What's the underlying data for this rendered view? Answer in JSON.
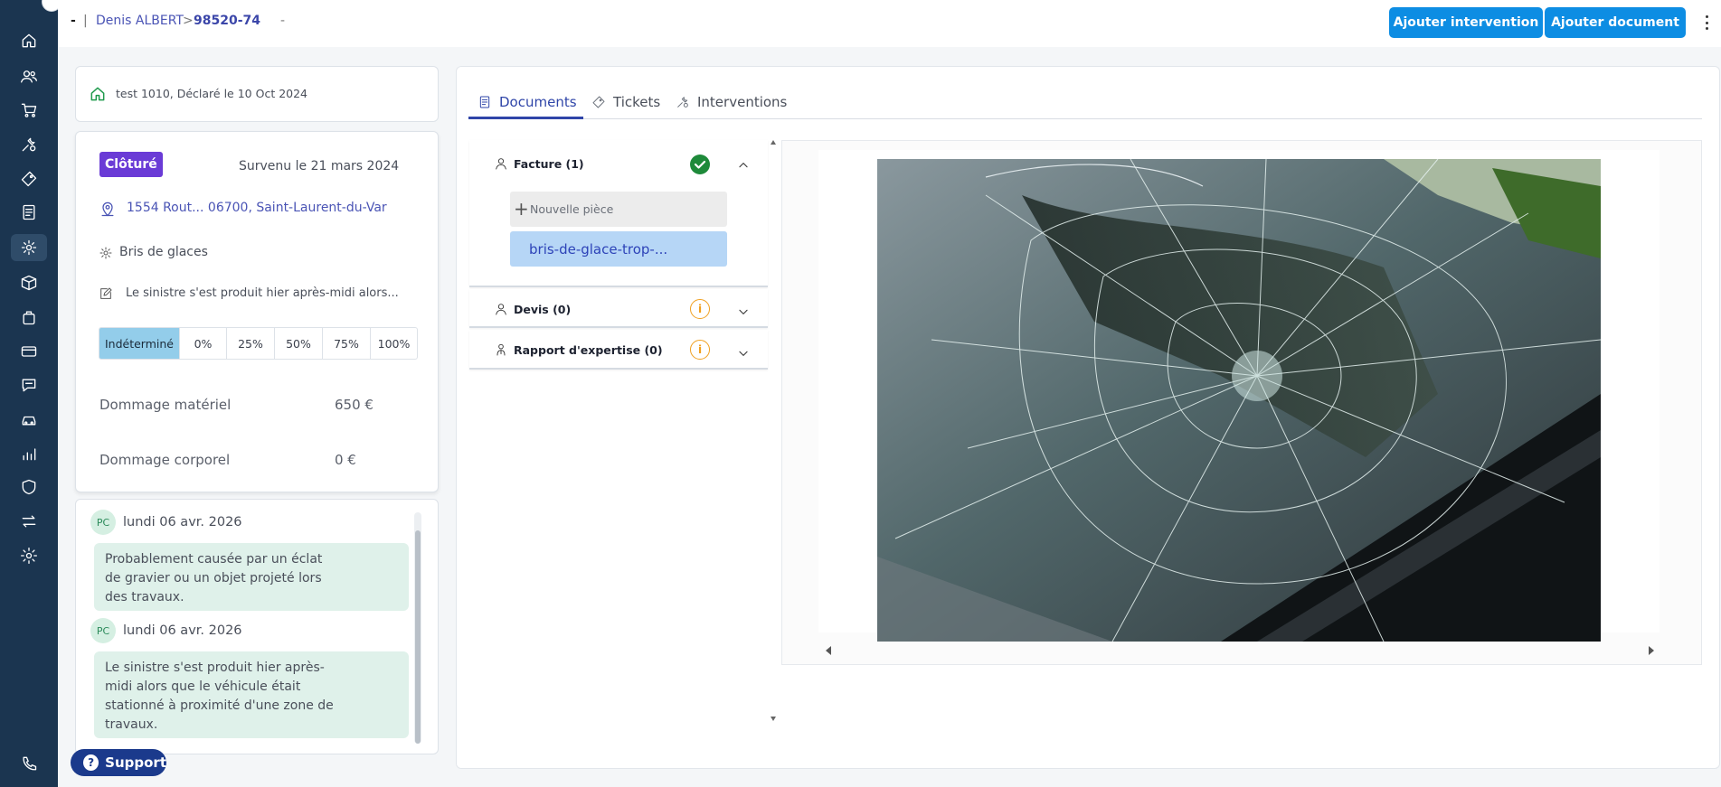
{
  "header": {
    "breadcrumb_dash": "-",
    "breadcrumb_sep": "|",
    "client_name": "Denis ALBERT",
    "chevron": ">",
    "case_id": "98520-74",
    "trailing_dash": "-",
    "add_intervention_label": "Ajouter intervention",
    "add_document_label": "Ajouter document"
  },
  "sidebar": {
    "items": [
      {
        "icon": "home-icon"
      },
      {
        "icon": "users-icon"
      },
      {
        "icon": "cart-icon"
      },
      {
        "icon": "tools-icon"
      },
      {
        "icon": "ticket-icon"
      },
      {
        "icon": "document-icon"
      },
      {
        "icon": "claims-icon"
      },
      {
        "icon": "box-icon"
      },
      {
        "icon": "bag-icon"
      },
      {
        "icon": "card-icon"
      },
      {
        "icon": "chat-icon"
      },
      {
        "icon": "car-icon"
      },
      {
        "icon": "stats-icon"
      },
      {
        "icon": "shield-icon"
      },
      {
        "icon": "transfer-icon"
      },
      {
        "icon": "settings-icon"
      }
    ],
    "bottom_icon": "phone-icon",
    "active_index": 6
  },
  "claim": {
    "summary": "test 1010, Déclaré le 10 Oct 2024",
    "status_badge": "Clôturé",
    "survenu": "Survenu le 21 mars 2024",
    "address": "1554 Rout...  06700, Saint-Laurent-du-Var",
    "type": "Bris de glaces",
    "description": "Le sinistre s'est produit hier après-midi alors...",
    "responsibility_options": [
      "Indéterminé",
      "0%",
      "25%",
      "50%",
      "75%",
      "100%"
    ],
    "responsibility_selected": "Indéterminé",
    "damage_material_label": "Dommage matériel",
    "damage_material_value": "650 €",
    "damage_bodily_label": "Dommage corporel",
    "damage_bodily_value": "0 €"
  },
  "notes": [
    {
      "initials": "PC",
      "date": "lundi 06 avr. 2026",
      "text": "Probablement causée par un éclat de gravier ou un objet projeté lors des travaux."
    },
    {
      "initials": "PC",
      "date": "lundi 06 avr. 2026",
      "text": "Le sinistre s'est produit hier après-midi alors que le véhicule était stationné à proximité d'une zone de travaux."
    }
  ],
  "support_label": "Support",
  "tabs": [
    {
      "label": "Documents",
      "icon": "document-icon",
      "active": true
    },
    {
      "label": "Tickets",
      "icon": "ticket-icon",
      "active": false
    },
    {
      "label": "Interventions",
      "icon": "tools-icon",
      "active": false
    }
  ],
  "documents": {
    "sections": [
      {
        "title": "Facture (1)",
        "status": "ok",
        "expanded": true
      },
      {
        "title": "Devis (0)",
        "status": "warning",
        "expanded": false
      },
      {
        "title": "Rapport d'expertise (0)",
        "status": "warning",
        "expanded": false
      }
    ],
    "new_piece_label": "Nouvelle pièce",
    "file_name": "bris-de-glace-trop-...",
    "warning_glyph": "i"
  },
  "viewer": {
    "image_subject": "cracked windshield photo"
  },
  "colors": {
    "sidebar": "#1b3550",
    "primary_button": "#0d8de3",
    "badge": "#6a3bd6",
    "active_tab": "#2f45a8",
    "ok": "#1e8a3a",
    "warning": "#f0a020"
  }
}
